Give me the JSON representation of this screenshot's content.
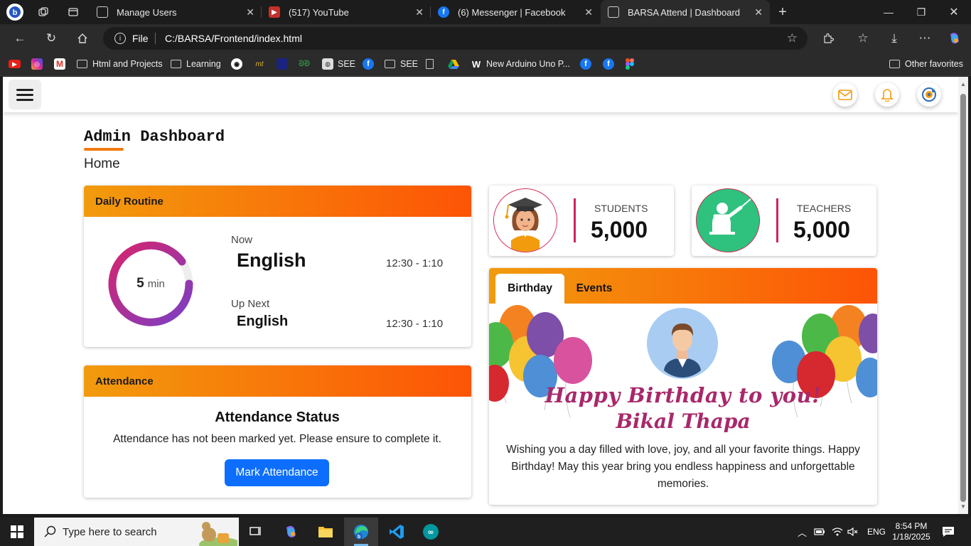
{
  "browser": {
    "tabs": [
      {
        "title": "Manage Users",
        "active": false
      },
      {
        "title": "(517) YouTube",
        "active": false
      },
      {
        "title": "(6) Messenger | Facebook",
        "active": false
      },
      {
        "title": "BARSA Attend | Dashboard",
        "active": true
      }
    ],
    "address": {
      "scheme_label": "File",
      "url": "C:/BARSA/Frontend/index.html"
    },
    "bookmarks": [
      {
        "label": "Html and Projects",
        "type": "folder"
      },
      {
        "label": "Learning",
        "type": "folder"
      },
      {
        "label": "SEE",
        "type": "site"
      },
      {
        "label": "SEE",
        "type": "folder"
      },
      {
        "label": "New Arduino Uno P...",
        "type": "site"
      }
    ],
    "other_favorites": "Other favorites"
  },
  "app": {
    "page_title": "Admin Dashboard",
    "breadcrumb": "Home",
    "accent_color": "#f07a10",
    "header_gradient": [
      "#f29b0d",
      "#fd5406"
    ],
    "routine": {
      "title": "Daily Routine",
      "remaining_value": "5",
      "remaining_unit": "min",
      "now_label": "Now",
      "now_subject": "English",
      "now_time": "12:30 - 1:10",
      "next_label": "Up Next",
      "next_subject": "English",
      "next_time": "12:30 - 1:10"
    },
    "attendance": {
      "title": "Attendance",
      "status_title": "Attendance Status",
      "message": "Attendance has not been marked yet. Please ensure to complete it.",
      "button": "Mark Attendance"
    },
    "stats": [
      {
        "label": "STUDENTS",
        "value": "5,000",
        "icon": "graduate-student-icon"
      },
      {
        "label": "TEACHERS",
        "value": "5,000",
        "icon": "teacher-board-icon"
      }
    ],
    "birthday": {
      "tabs": [
        "Birthday",
        "Events"
      ],
      "active_tab": "Birthday",
      "greeting": "Happy Birthday to you!",
      "name": "Bikal Thapa",
      "message": "Wishing you a day filled with love, joy, and all your favorite things. Happy Birthday! May this year bring you endless happiness and unforgettable memories."
    }
  },
  "taskbar": {
    "search_placeholder": "Type here to search",
    "language": "ENG",
    "time": "8:54 PM",
    "date": "1/18/2025"
  }
}
